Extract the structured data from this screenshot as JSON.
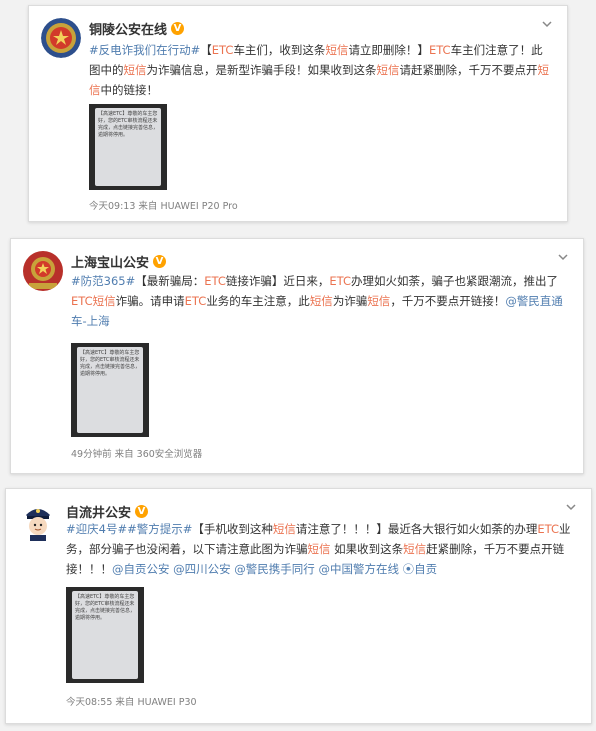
{
  "posts": [
    {
      "account": "铜陵公安在线",
      "text": [
        {
          "t": "#反电诈我们在行动#",
          "s": "blue"
        },
        {
          "t": "【",
          "s": ""
        },
        {
          "t": "ETC",
          "s": "hl"
        },
        {
          "t": "车主们，收到这条",
          "s": ""
        },
        {
          "t": "短信",
          "s": "hl"
        },
        {
          "t": "请立即删除！】",
          "s": ""
        },
        {
          "t": "ETC",
          "s": "hl"
        },
        {
          "t": "车主们注意了！此图中的",
          "s": ""
        },
        {
          "t": "短信",
          "s": "hl"
        },
        {
          "t": "为诈骗信息，是新型诈骗手段！如果收到这条",
          "s": ""
        },
        {
          "t": "短信",
          "s": "hl"
        },
        {
          "t": "请赶紧删除，千万不要点开",
          "s": ""
        },
        {
          "t": "短信",
          "s": "hl"
        },
        {
          "t": "中的链接！",
          "s": ""
        }
      ],
      "image_text": "【高速ETC】尊敬的车主您好，您的ETC审核流程还未完成，点击链接完善信息，逾期将停用。",
      "time": "今天09:13",
      "source": "来自 HUAWEI P20 Pro"
    },
    {
      "account": "上海宝山公安",
      "text": [
        {
          "t": "#防范365#",
          "s": "blue"
        },
        {
          "t": "【最新骗局：",
          "s": ""
        },
        {
          "t": "ETC",
          "s": "hl"
        },
        {
          "t": "链接诈骗】近日来，",
          "s": ""
        },
        {
          "t": "ETC",
          "s": "hl"
        },
        {
          "t": "办理如火如荼，骗子也紧跟潮流，推出了",
          "s": ""
        },
        {
          "t": "ETC短信",
          "s": "hl"
        },
        {
          "t": "诈骗。请申请",
          "s": ""
        },
        {
          "t": "ETC",
          "s": "hl"
        },
        {
          "t": "业务的车主注意，此",
          "s": ""
        },
        {
          "t": "短信",
          "s": "hl"
        },
        {
          "t": "为诈骗",
          "s": ""
        },
        {
          "t": "短信",
          "s": "hl"
        },
        {
          "t": "，千万不要点开链接！",
          "s": ""
        },
        {
          "t": "@警民直通车-上海",
          "s": "blue"
        }
      ],
      "image_text": "【高速ETC】尊敬的车主您好，您的ETC审核流程还未完成，点击链接完善信息，逾期将停用。",
      "time": "49分钟前",
      "source": "来自 360安全浏览器"
    },
    {
      "account": "自流井公安",
      "text": [
        {
          "t": "#迎庆4号##警方提示#",
          "s": "blue"
        },
        {
          "t": "【手机收到这种",
          "s": ""
        },
        {
          "t": "短信",
          "s": "hl"
        },
        {
          "t": "请注意了！！！】最近各大银行如火如荼的办理",
          "s": ""
        },
        {
          "t": "ETC",
          "s": "hl"
        },
        {
          "t": "业务，部分骗子也没闲着，以下请注意此图为诈骗",
          "s": ""
        },
        {
          "t": "短信",
          "s": "hl"
        },
        {
          "t": " 如果收到这条",
          "s": ""
        },
        {
          "t": "短信",
          "s": "hl"
        },
        {
          "t": "赶紧删除，千万不要点开链接！！！",
          "s": ""
        },
        {
          "t": "@自贡公安 @四川公安 @警民携手同行 @中国警方在线 ⦿自贡",
          "s": "blue"
        }
      ],
      "image_text": "【高速ETC】尊敬的车主您好，您的ETC审核流程还未完成，点击链接完善信息，逾期将停用。",
      "time": "今天08:55",
      "source": "来自 HUAWEI P30"
    }
  ],
  "icons": {
    "verified": "V",
    "chevron": "chevron-down-icon"
  },
  "colors": {
    "highlight": "#eb7350",
    "link": "#507daf",
    "verified": "#ffa200"
  }
}
